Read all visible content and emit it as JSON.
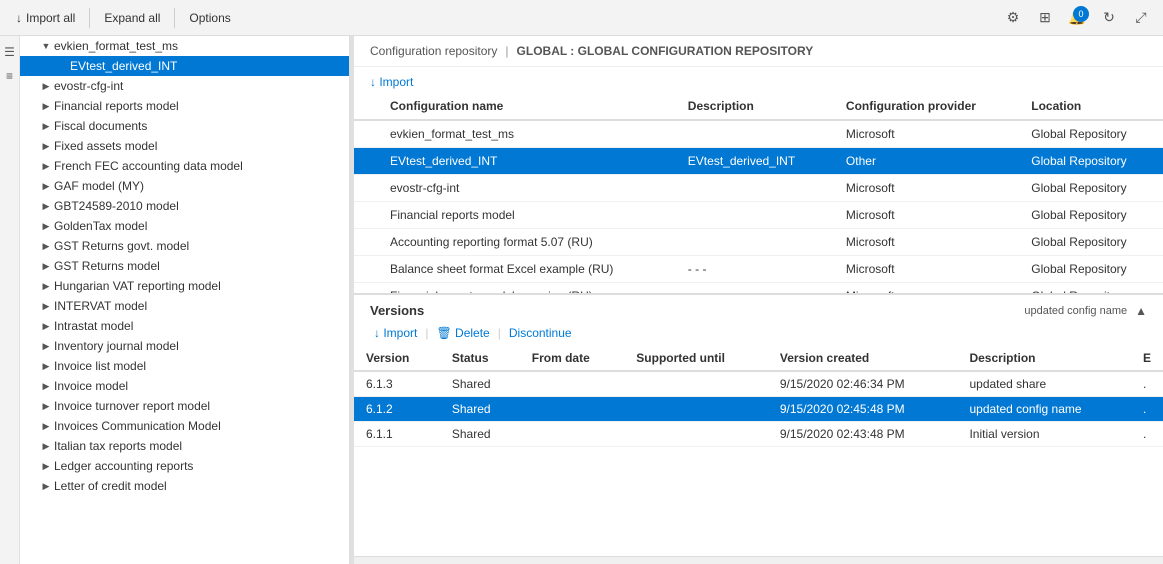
{
  "toolbar": {
    "import_all_label": "Import all",
    "expand_all_label": "Expand all",
    "options_label": "Options"
  },
  "breadcrumb": {
    "part1": "Configuration repository",
    "separator": "|",
    "part2": "GLOBAL : GLOBAL CONFIGURATION REPOSITORY"
  },
  "import_button": "↓ Import",
  "config_table": {
    "columns": [
      "",
      "Configuration name",
      "Description",
      "Configuration provider",
      "Location"
    ],
    "rows": [
      {
        "check": false,
        "name": "evkien_format_test_ms",
        "description": "",
        "provider": "Microsoft",
        "location": "Global Repository",
        "selected": false,
        "highlighted": false
      },
      {
        "check": false,
        "name": "EVtest_derived_INT",
        "description": "EVtest_derived_INT",
        "provider": "Other",
        "location": "Global Repository",
        "selected": false,
        "highlighted": true
      },
      {
        "check": false,
        "name": "evostr-cfg-int",
        "description": "",
        "provider": "Microsoft",
        "location": "Global Repository",
        "selected": false,
        "highlighted": false
      },
      {
        "check": false,
        "name": "Financial reports model",
        "description": "",
        "provider": "Microsoft",
        "location": "Global Repository",
        "selected": false,
        "highlighted": false
      },
      {
        "check": false,
        "name": "Accounting reporting format 5.07 (RU)",
        "description": "",
        "provider": "Microsoft",
        "location": "Global Repository",
        "selected": false,
        "highlighted": false
      },
      {
        "check": false,
        "name": "Balance sheet format Excel example (RU)",
        "description": "- - -",
        "provider": "Microsoft",
        "location": "Global Repository",
        "selected": false,
        "highlighted": false
      },
      {
        "check": false,
        "name": "Financial reports model mapping (RU)",
        "description": "",
        "provider": "Microsoft",
        "location": "Global Repository",
        "selected": false,
        "highlighted": false
      }
    ]
  },
  "versions": {
    "title": "Versions",
    "updated_label": "updated config name",
    "import_label": "↓ Import",
    "delete_label": "🗑 Delete",
    "discontinue_label": "Discontinue",
    "columns": [
      "Version",
      "Status",
      "From date",
      "Supported until",
      "Version created",
      "Description",
      "E"
    ],
    "rows": [
      {
        "version": "6.1.3",
        "status": "Shared",
        "from_date": "",
        "supported_until": "",
        "created": "9/15/2020 02:46:34 PM",
        "description": "updated share",
        "e": ".",
        "highlighted": false
      },
      {
        "version": "6.1.2",
        "status": "Shared",
        "from_date": "",
        "supported_until": "",
        "created": "9/15/2020 02:45:48 PM",
        "description": "updated config name",
        "e": ".",
        "highlighted": true
      },
      {
        "version": "6.1.1",
        "status": "Shared",
        "from_date": "",
        "supported_until": "",
        "created": "9/15/2020 02:43:48 PM",
        "description": "Initial version",
        "e": ".",
        "highlighted": false
      }
    ]
  },
  "tree": {
    "items": [
      {
        "indent": 1,
        "expanded": true,
        "label": "evkien_format_test_ms",
        "selected": false
      },
      {
        "indent": 2,
        "expanded": false,
        "label": "EVtest_derived_INT",
        "selected": true,
        "highlighted": true
      },
      {
        "indent": 1,
        "expanded": false,
        "label": "evostr-cfg-int",
        "selected": false
      },
      {
        "indent": 1,
        "expanded": false,
        "label": "Financial reports model",
        "selected": false
      },
      {
        "indent": 1,
        "expanded": false,
        "label": "Fiscal documents",
        "selected": false
      },
      {
        "indent": 1,
        "expanded": false,
        "label": "Fixed assets model",
        "selected": false
      },
      {
        "indent": 1,
        "expanded": false,
        "label": "French FEC accounting data model",
        "selected": false
      },
      {
        "indent": 1,
        "expanded": false,
        "label": "GAF model (MY)",
        "selected": false
      },
      {
        "indent": 1,
        "expanded": false,
        "label": "GBT24589-2010 model",
        "selected": false
      },
      {
        "indent": 1,
        "expanded": false,
        "label": "GoldenTax model",
        "selected": false
      },
      {
        "indent": 1,
        "expanded": false,
        "label": "GST Returns govt. model",
        "selected": false
      },
      {
        "indent": 1,
        "expanded": false,
        "label": "GST Returns model",
        "selected": false
      },
      {
        "indent": 1,
        "expanded": false,
        "label": "Hungarian VAT reporting model",
        "selected": false
      },
      {
        "indent": 1,
        "expanded": false,
        "label": "INTERVAT model",
        "selected": false
      },
      {
        "indent": 1,
        "expanded": false,
        "label": "Intrastat model",
        "selected": false
      },
      {
        "indent": 1,
        "expanded": false,
        "label": "Inventory journal model",
        "selected": false
      },
      {
        "indent": 1,
        "expanded": false,
        "label": "Invoice list model",
        "selected": false
      },
      {
        "indent": 1,
        "expanded": false,
        "label": "Invoice model",
        "selected": false
      },
      {
        "indent": 1,
        "expanded": false,
        "label": "Invoice turnover report model",
        "selected": false
      },
      {
        "indent": 1,
        "expanded": false,
        "label": "Invoices Communication Model",
        "selected": false
      },
      {
        "indent": 1,
        "expanded": false,
        "label": "Italian tax reports model",
        "selected": false
      },
      {
        "indent": 1,
        "expanded": false,
        "label": "Ledger accounting reports",
        "selected": false
      },
      {
        "indent": 1,
        "expanded": false,
        "label": "Letter of credit model",
        "selected": false
      }
    ]
  }
}
